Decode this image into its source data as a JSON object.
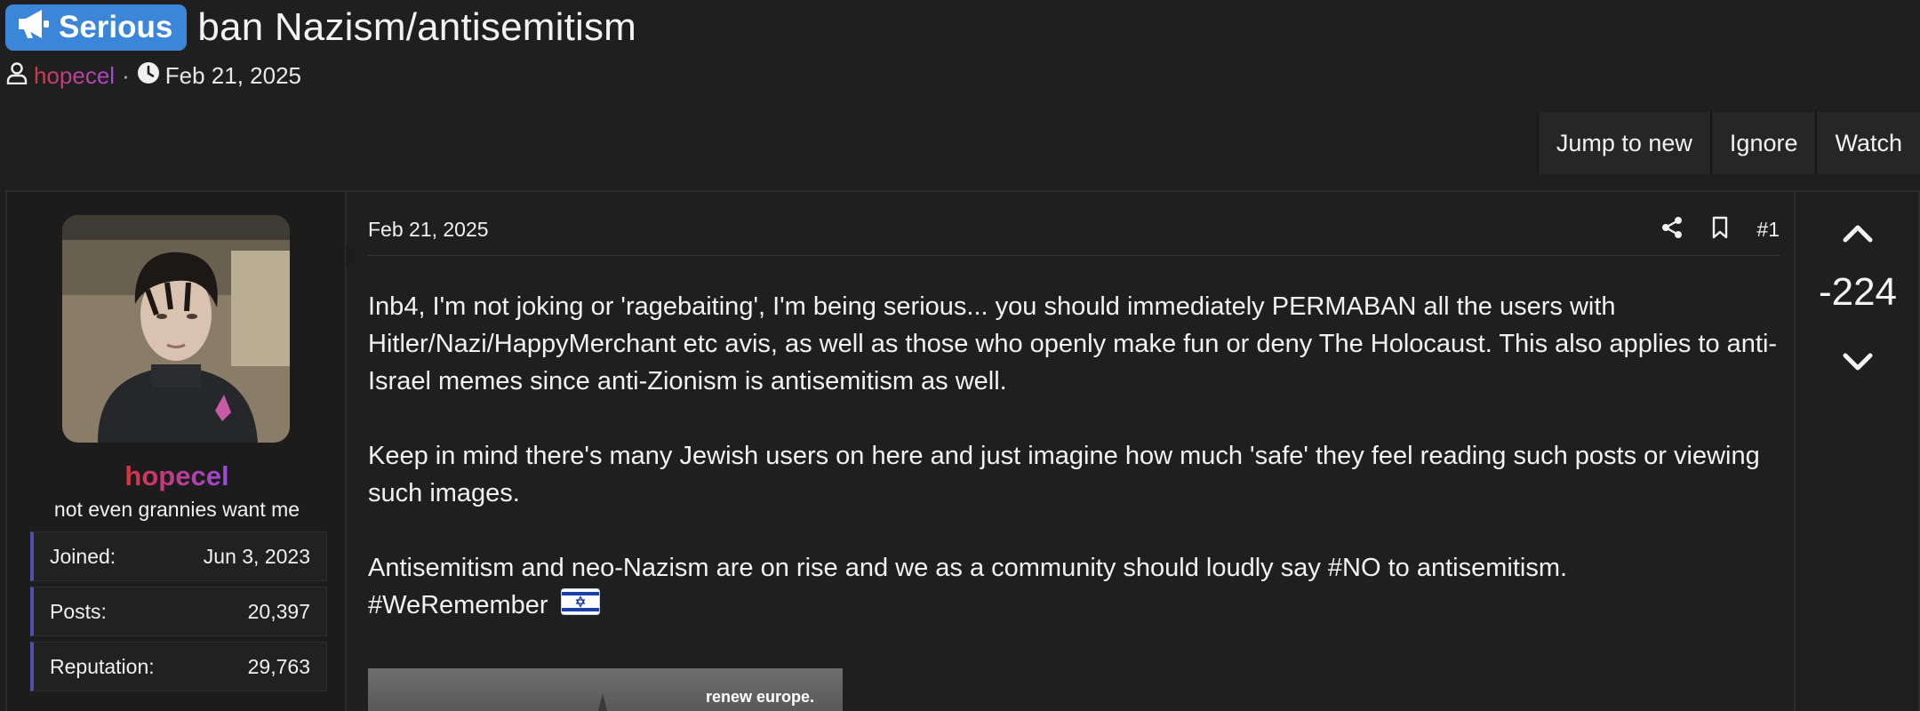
{
  "thread": {
    "prefix": "Serious",
    "title": "ban Nazism/antisemitism",
    "author": "hopecel",
    "separator": "·",
    "date": "Feb 21, 2025"
  },
  "actions": {
    "jump_to_new": "Jump to new",
    "ignore": "Ignore",
    "watch": "Watch"
  },
  "user": {
    "name": "hopecel",
    "title": "not even grannies want me",
    "stats": [
      {
        "label": "Joined:",
        "value": "Jun 3, 2023"
      },
      {
        "label": "Posts:",
        "value": "20,397"
      },
      {
        "label": "Reputation:",
        "value": "29,763"
      }
    ]
  },
  "post": {
    "date": "Feb 21, 2025",
    "number": "#1",
    "paragraphs": [
      "Inb4, I'm not joking or 'ragebaiting', I'm being serious... you should immediately PERMABAN all the users with Hitler/Nazi/HappyMerchant etc avis, as well as those who openly make fun or deny The Holocaust. This also applies to anti-Israel memes since anti-Zionism is antisemitism as well.",
      "Keep in mind there's many Jewish users on here and just imagine how much 'safe' they feel reading such posts or viewing such images.",
      "Antisemitism and neo-Nazism are on rise and we as a community should loudly say #NO to antisemitism.",
      "#WeRemember"
    ],
    "image_caption": "renew europe."
  },
  "vote": {
    "score": "-224"
  },
  "icons": {
    "prefix": "megaphone-icon",
    "author": "user-icon",
    "date": "clock-icon",
    "share": "share-icon",
    "bookmark": "bookmark-icon",
    "upvote": "chevron-up-icon",
    "downvote": "chevron-down-icon",
    "flag": "israel-flag-icon"
  },
  "colors": {
    "background": "#1f1f1f",
    "prefix_badge": "#3b86d8",
    "username_gradient_start": "#d83440",
    "username_gradient_end": "#9c48e0",
    "stat_accent": "#4b50a8"
  }
}
